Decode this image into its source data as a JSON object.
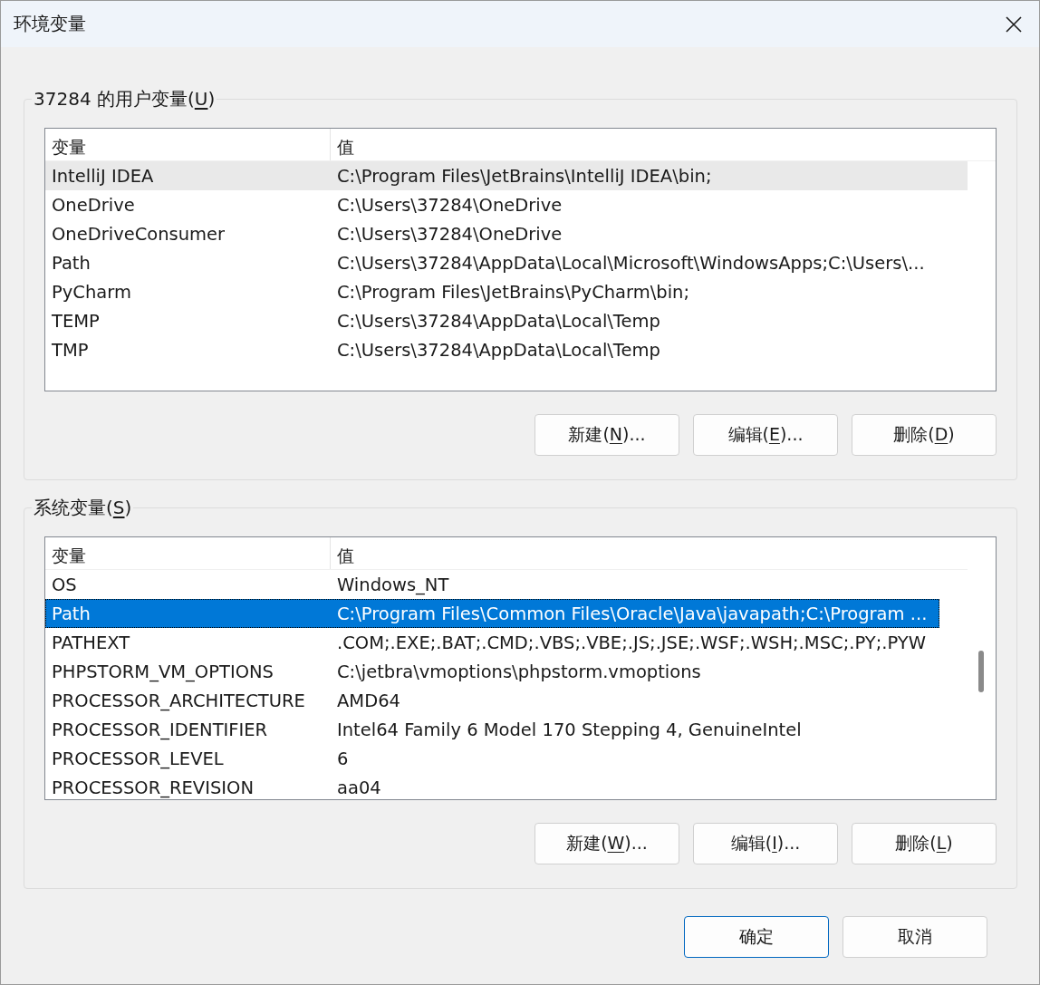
{
  "window": {
    "title": "环境变量"
  },
  "user_variables": {
    "label": {
      "pre": "37284 的用户变量(",
      "key": "U",
      "post": ")"
    },
    "columns": [
      "变量",
      "值"
    ],
    "rows": [
      {
        "name": "IntelliJ IDEA",
        "value": "C:\\Program Files\\JetBrains\\IntelliJ IDEA\\bin;",
        "selected": false,
        "hovered": true
      },
      {
        "name": "OneDrive",
        "value": "C:\\Users\\37284\\OneDrive",
        "selected": false,
        "hovered": false
      },
      {
        "name": "OneDriveConsumer",
        "value": "C:\\Users\\37284\\OneDrive",
        "selected": false,
        "hovered": false
      },
      {
        "name": "Path",
        "value": "C:\\Users\\37284\\AppData\\Local\\Microsoft\\WindowsApps;C:\\Users\\...",
        "selected": false,
        "hovered": false
      },
      {
        "name": "PyCharm",
        "value": "C:\\Program Files\\JetBrains\\PyCharm\\bin;",
        "selected": false,
        "hovered": false
      },
      {
        "name": "TEMP",
        "value": "C:\\Users\\37284\\AppData\\Local\\Temp",
        "selected": false,
        "hovered": false
      },
      {
        "name": "TMP",
        "value": "C:\\Users\\37284\\AppData\\Local\\Temp",
        "selected": false,
        "hovered": false
      }
    ],
    "buttons": [
      {
        "pre": "新建(",
        "key": "N",
        "post": ")..."
      },
      {
        "pre": "编辑(",
        "key": "E",
        "post": ")..."
      },
      {
        "pre": "删除(",
        "key": "D",
        "post": ")"
      }
    ]
  },
  "system_variables": {
    "label": {
      "pre": "系统变量(",
      "key": "S",
      "post": ")"
    },
    "columns": [
      "变量",
      "值"
    ],
    "scrollbar": true,
    "rows": [
      {
        "name": "OS",
        "value": "Windows_NT",
        "selected": false,
        "hovered": false
      },
      {
        "name": "Path",
        "value": "C:\\Program Files\\Common Files\\Oracle\\Java\\javapath;C:\\Program ...",
        "selected": true,
        "hovered": false
      },
      {
        "name": "PATHEXT",
        "value": ".COM;.EXE;.BAT;.CMD;.VBS;.VBE;.JS;.JSE;.WSF;.WSH;.MSC;.PY;.PYW",
        "selected": false,
        "hovered": false
      },
      {
        "name": "PHPSTORM_VM_OPTIONS",
        "value": "C:\\jetbra\\vmoptions\\phpstorm.vmoptions",
        "selected": false,
        "hovered": false
      },
      {
        "name": "PROCESSOR_ARCHITECTURE",
        "value": "AMD64",
        "selected": false,
        "hovered": false
      },
      {
        "name": "PROCESSOR_IDENTIFIER",
        "value": "Intel64 Family 6 Model 170 Stepping 4, GenuineIntel",
        "selected": false,
        "hovered": false
      },
      {
        "name": "PROCESSOR_LEVEL",
        "value": "6",
        "selected": false,
        "hovered": false
      },
      {
        "name": "PROCESSOR_REVISION",
        "value": "aa04",
        "selected": false,
        "hovered": false
      }
    ],
    "buttons": [
      {
        "pre": "新建(",
        "key": "W",
        "post": ")..."
      },
      {
        "pre": "编辑(",
        "key": "I",
        "post": ")..."
      },
      {
        "pre": "删除(",
        "key": "L",
        "post": ")"
      }
    ]
  },
  "footer_buttons": [
    {
      "label": "确定",
      "default": true
    },
    {
      "label": "取消",
      "default": false
    }
  ]
}
